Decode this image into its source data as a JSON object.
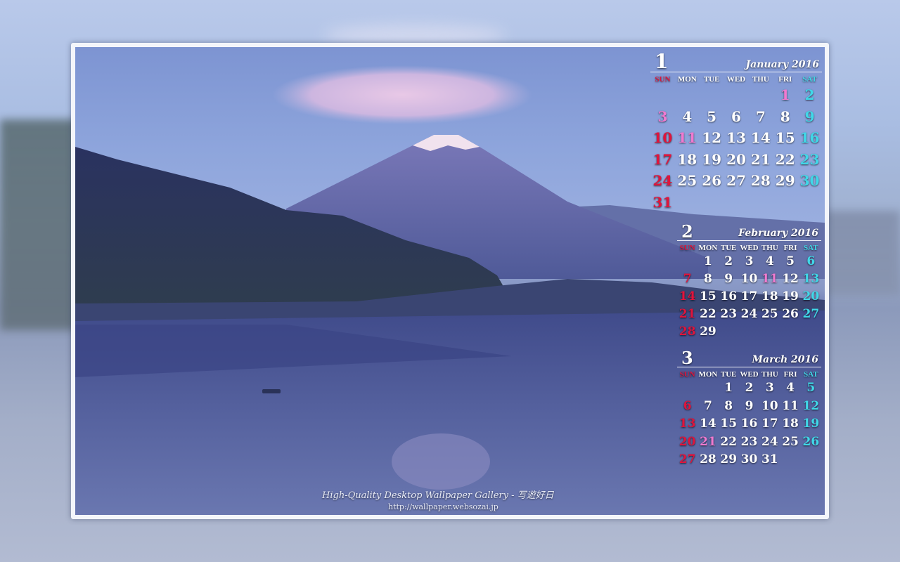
{
  "credit": {
    "line1": "High-Quality Desktop Wallpaper Gallery - 写遊好日",
    "line2": "http://wallpaper.websozai.jp"
  },
  "weekdays": [
    "SUN",
    "MON",
    "TUE",
    "WED",
    "THU",
    "FRI",
    "SAT"
  ],
  "calendars": [
    {
      "month_number": "1",
      "month_name": "January 2016",
      "weeks": [
        [
          "",
          "",
          "",
          "",
          "",
          "1",
          "2"
        ],
        [
          "3",
          "4",
          "5",
          "6",
          "7",
          "8",
          "9"
        ],
        [
          "10",
          "11",
          "12",
          "13",
          "14",
          "15",
          "16"
        ],
        [
          "17",
          "18",
          "19",
          "20",
          "21",
          "22",
          "23"
        ],
        [
          "24",
          "25",
          "26",
          "27",
          "28",
          "29",
          "30"
        ],
        [
          "31",
          "",
          "",
          "",
          "",
          "",
          ""
        ]
      ],
      "holidays": [
        "1",
        "3",
        "11"
      ]
    },
    {
      "month_number": "2",
      "month_name": "February 2016",
      "weeks": [
        [
          "",
          "1",
          "2",
          "3",
          "4",
          "5",
          "6"
        ],
        [
          "7",
          "8",
          "9",
          "10",
          "11",
          "12",
          "13"
        ],
        [
          "14",
          "15",
          "16",
          "17",
          "18",
          "19",
          "20"
        ],
        [
          "21",
          "22",
          "23",
          "24",
          "25",
          "26",
          "27"
        ],
        [
          "28",
          "29",
          "",
          "",
          "",
          "",
          ""
        ]
      ],
      "holidays": [
        "11"
      ]
    },
    {
      "month_number": "3",
      "month_name": "March 2016",
      "weeks": [
        [
          "",
          "",
          "1",
          "2",
          "3",
          "4",
          "5"
        ],
        [
          "6",
          "7",
          "8",
          "9",
          "10",
          "11",
          "12"
        ],
        [
          "13",
          "14",
          "15",
          "16",
          "17",
          "18",
          "19"
        ],
        [
          "20",
          "21",
          "22",
          "23",
          "24",
          "25",
          "26"
        ],
        [
          "27",
          "28",
          "29",
          "30",
          "31",
          "",
          ""
        ]
      ],
      "holidays": [
        "21"
      ]
    }
  ],
  "colors": {
    "sunday": "#e0143c",
    "saturday": "#40d8e8",
    "holiday": "#f07ad0"
  }
}
